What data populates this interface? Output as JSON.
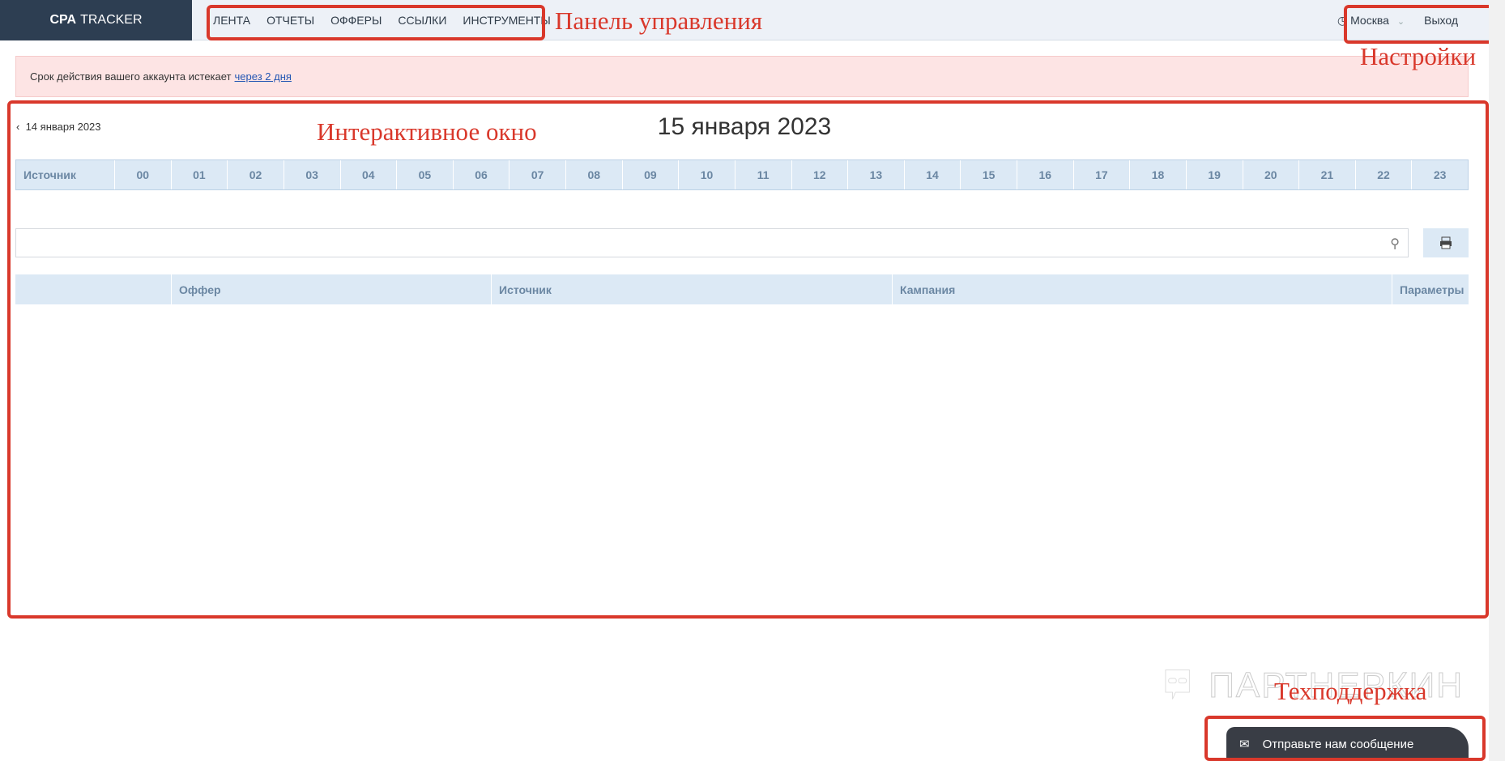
{
  "header": {
    "logo_bold": "CPA",
    "logo_rest": "TRACKER",
    "nav": [
      "ЛЕНТА",
      "ОТЧЕТЫ",
      "ОФФЕРЫ",
      "ССЫЛКИ",
      "ИНСТРУМЕНТЫ"
    ],
    "timezone": "Москва",
    "logout": "Выход"
  },
  "alert": {
    "text": "Срок действия вашего аккаунта истекает",
    "link": "через 2 дня"
  },
  "main": {
    "prev_date": "14 января 2023",
    "title": "15 января 2023",
    "hours_header": {
      "source": "Источник",
      "hours": [
        "00",
        "01",
        "02",
        "03",
        "04",
        "05",
        "06",
        "07",
        "08",
        "09",
        "10",
        "11",
        "12",
        "13",
        "14",
        "15",
        "16",
        "17",
        "18",
        "19",
        "20",
        "21",
        "22",
        "23"
      ]
    },
    "search": {
      "value": "",
      "placeholder": ""
    },
    "table_columns": [
      "",
      "Оффер",
      "Источник",
      "Кампания",
      "Параметры"
    ]
  },
  "annotations": {
    "nav": "Панель управления",
    "settings": "Настройки",
    "main": "Интерактивное окно",
    "support": "Техподдержка"
  },
  "watermark": "ПАРТНЕРКИН",
  "chat": {
    "label": "Отправьте нам сообщение"
  }
}
